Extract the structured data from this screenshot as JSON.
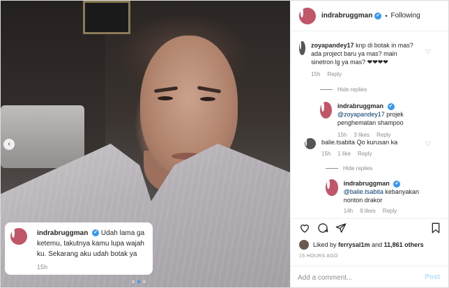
{
  "post": {
    "username": "indrabruggman",
    "follow_status": "Following",
    "separator": "•",
    "verified_mark": "✔",
    "caption_username": "indrabruggman",
    "caption_text": "Udah lama ga ketemu, takutnya kamu lupa wajah ku. Sekarang aku udah botak ya",
    "caption_time": "15h",
    "carousel": {
      "current_index": 1,
      "count": 3
    }
  },
  "comments": [
    {
      "username": "zoyapandey17",
      "text": "knp di botak in mas? ada project baru ya mas? main sinetron lg ya mas? ❤❤❤❤",
      "time": "15h",
      "reply_label": "Reply",
      "hide_replies_label": "Hide replies",
      "reply": {
        "username": "indrabruggman",
        "mention": "@zoyapandey17",
        "text": " projek penghematan shampoo",
        "time": "15h",
        "likes": "3 likes",
        "reply_label": "Reply"
      }
    },
    {
      "username": "balie.tsabita",
      "text": "Qo kurusan ka",
      "time": "15h",
      "likes": "1 like",
      "reply_label": "Reply",
      "hide_replies_label": "Hide replies",
      "reply": {
        "username": "indrabruggman",
        "mention": "@balie.tsabita",
        "text": " kebanyakan nonton drakor",
        "time": "14h",
        "likes": "9 likes",
        "reply_label": "Reply"
      }
    }
  ],
  "actions": {
    "liked_by_prefix": "Liked by ",
    "liked_by_user": "ferrysal1m",
    "liked_by_mid": " and ",
    "liked_by_count": "11,861 others",
    "time_ago": "15 HOURS AGO",
    "comment_placeholder": "Add a comment...",
    "post_button": "Post"
  },
  "icons": [
    "heart-icon",
    "comment-icon",
    "share-icon",
    "bookmark-icon",
    "chevron-left-icon",
    "verified-icon"
  ],
  "colors": {
    "link": "#00376b",
    "verified": "#3897f0",
    "post_disabled": "#b2dffc",
    "muted": "#8e8e8e"
  }
}
